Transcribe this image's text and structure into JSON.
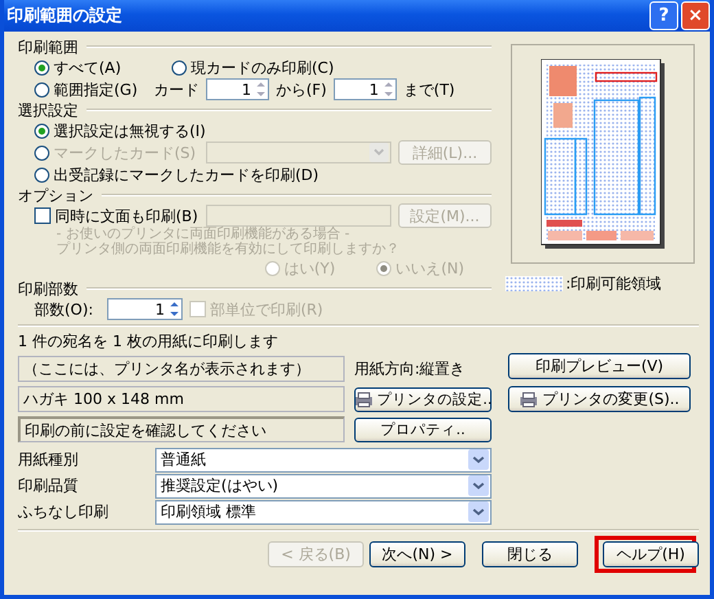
{
  "window": {
    "title": "印刷範囲の設定",
    "help_button": "?",
    "close_button": "×"
  },
  "print_range": {
    "heading": "印刷範囲",
    "options": [
      {
        "label": "すべて(A)",
        "selected": true
      },
      {
        "label": "現カードのみ印刷(C)",
        "selected": false
      },
      {
        "label": "範囲指定(G)",
        "selected": false
      }
    ],
    "card_label": "カード",
    "from_value": "1",
    "from_label": "から(F)",
    "to_value": "1",
    "to_label": "まで(T)"
  },
  "selection": {
    "heading": "選択設定",
    "options": [
      {
        "label": "選択設定は無視する(I)",
        "selected": true,
        "disabled": false
      },
      {
        "label": "マークしたカード(S)",
        "selected": false,
        "disabled": true
      },
      {
        "label": "出受記録にマークしたカードを印刷(D)",
        "selected": false,
        "disabled": false
      }
    ],
    "details_button": {
      "label": "詳細(L)...",
      "disabled": true
    }
  },
  "options": {
    "heading": "オプション",
    "duplex": {
      "label": "同時に文面も印刷(B)",
      "checked": false
    },
    "settings_button": {
      "label": "設定(M)...",
      "disabled": true
    },
    "note": [
      "- お使いのプリンタに両面印刷機能がある場合 -",
      "プリンタ側の両面印刷機能を有効にして印刷しますか？"
    ],
    "answers": [
      {
        "label": "はい(Y)",
        "selected": false
      },
      {
        "label": "いいえ(N)",
        "selected": true
      }
    ]
  },
  "copies": {
    "heading": "印刷部数",
    "label": "部数(O):",
    "value": "1",
    "collate": {
      "label": "部単位で印刷(R)",
      "checked": false,
      "disabled": true
    }
  },
  "preview": {
    "legend": ":印刷可能領域"
  },
  "summary": "1 件の宛名を 1 枚の用紙に印刷します",
  "printer": {
    "name": "（ここには、プリンタ名が表示されます）",
    "paper": "ハガキ 100 x 148 mm",
    "message": "印刷の前に設定を確認してください",
    "orientation": "用紙方向:縦置き",
    "settings_button": "プリンタの設定..",
    "properties_button": "プロパティ..",
    "preview_button": "印刷プレビュー(V)",
    "change_button": "プリンタの変更(S).."
  },
  "dropdowns": [
    {
      "label": "用紙種別",
      "value": "普通紙"
    },
    {
      "label": "印刷品質",
      "value": "推奨設定(はやい)"
    },
    {
      "label": "ふちなし印刷",
      "value": "印刷領域 標準"
    }
  ],
  "buttons": [
    {
      "label": "< 戻る(B)",
      "disabled": true,
      "highlighted": false
    },
    {
      "label": "次へ(N) >",
      "disabled": false,
      "highlighted": false
    },
    {
      "label": "閉じる",
      "disabled": false,
      "highlighted": false
    },
    {
      "label": "ヘルプ(H)",
      "disabled": false,
      "highlighted": true
    }
  ]
}
